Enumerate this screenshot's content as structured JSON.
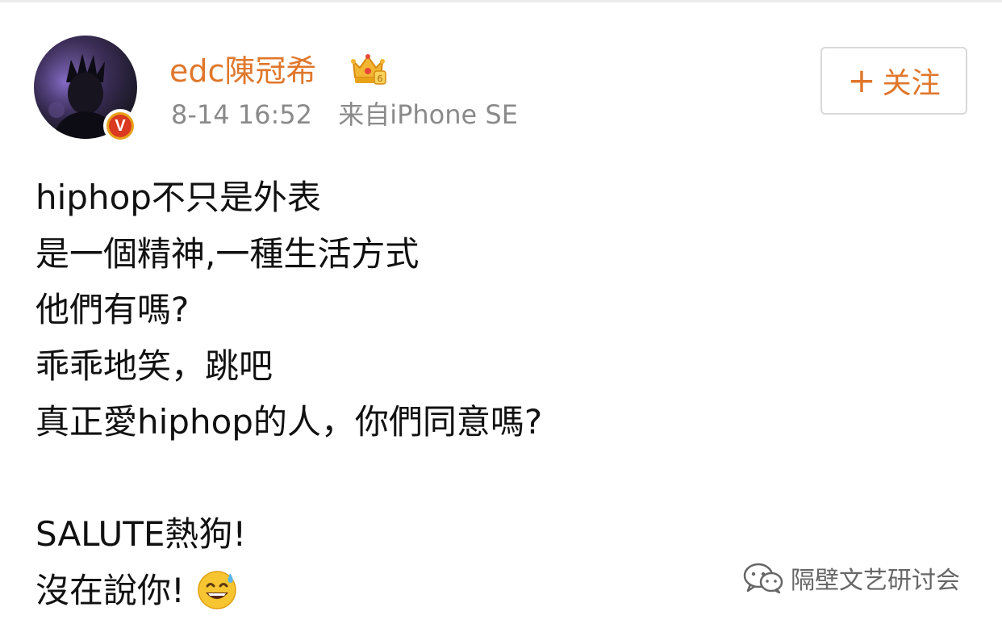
{
  "author": {
    "name": "edc陳冠希",
    "avatar_icon": "avatar-image",
    "verified_badge": "V",
    "level_icon": "crown-icon"
  },
  "meta": {
    "time": "8-14 16:52",
    "source": "来自iPhone SE"
  },
  "follow_button": {
    "plus": "+",
    "label": "关注"
  },
  "post": {
    "lines": [
      "hiphop不只是外表",
      "是一個精神,一種生活方式",
      "他們有嗎?",
      "乖乖地笑，跳吧",
      "真正愛hiphop的人，你們同意嗎?",
      "",
      "SALUTE熱狗!",
      "沒在說你!"
    ],
    "trailing_emoji": "grinning-sweat-emoji"
  },
  "watermark": {
    "text": "隔壁文艺研讨会",
    "icon": "wechat-icon"
  },
  "colors": {
    "accent": "#e0772b",
    "meta_text": "#8a8a8a",
    "body_text": "#111111",
    "badge_gold": "#e8a21a"
  }
}
